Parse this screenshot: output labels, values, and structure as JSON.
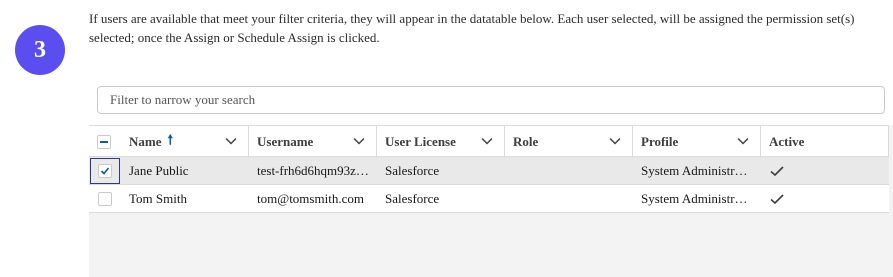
{
  "step": {
    "number": "3"
  },
  "description": "If users are available that meet your filter criteria, they will appear in the datatable below. Each user selected, will be assigned the permission set(s) selected; once the Assign or Schedule Assign is clicked.",
  "search": {
    "placeholder": "Filter to narrow your search",
    "value": ""
  },
  "table": {
    "columns": [
      {
        "label": "Name",
        "sorted": "ascending"
      },
      {
        "label": "Username"
      },
      {
        "label": "User License"
      },
      {
        "label": "Role"
      },
      {
        "label": "Profile"
      },
      {
        "label": "Active"
      }
    ],
    "rows": [
      {
        "selected": true,
        "name": "Jane Public",
        "username": "test-frh6d6hqm93z…",
        "license": "Salesforce",
        "role": "",
        "profile": "System Administr…",
        "active": true
      },
      {
        "selected": false,
        "name": "Tom Smith",
        "username": "tom@tomsmith.com",
        "license": "Salesforce",
        "role": "",
        "profile": "System Administr…",
        "active": true
      }
    ]
  },
  "colors": {
    "step_badge": "#5b4ef0",
    "accent": "#0b5cab"
  }
}
